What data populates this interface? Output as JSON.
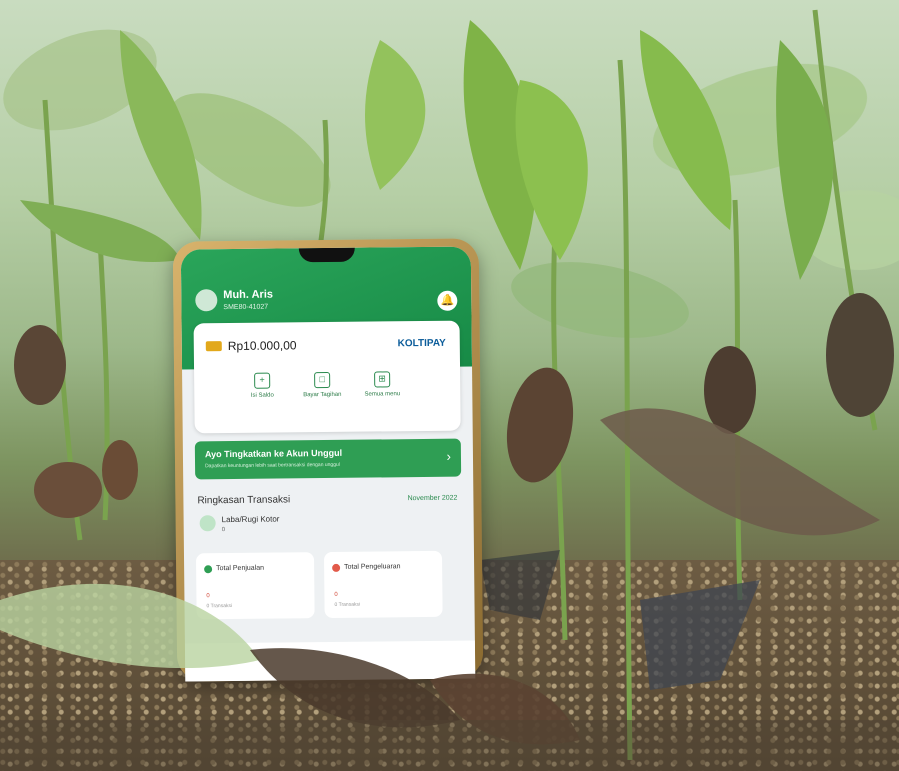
{
  "phone": {
    "user_name": "Muh. Aris",
    "user_id": "SME80-41027",
    "balance": "Rp10.000,00",
    "brand": "KOLTIPAY",
    "menu": [
      "Isi Saldo",
      "Bayar Tagihan",
      "Semua menu"
    ],
    "banner_title": "Ayo Tingkatkan ke Akun Unggul",
    "banner_sub": "Dapatkan keuntungan lebih saat bertransaksi dengan unggul",
    "section_title": "Ringkasan Transaksi",
    "month": "November 2022",
    "profit_label": "Laba/Rugi Kotor",
    "profit_value": "0",
    "sales_label": "Total Penjualan",
    "sales_value": "0",
    "sales_count": "0 Transaksi",
    "expense_label": "Total Pengeluaran",
    "expense_value": "0",
    "expense_count": "0 Transaksi"
  },
  "colors": {
    "header_green": "#1f9a50",
    "brand_blue": "#0b5c9a"
  }
}
